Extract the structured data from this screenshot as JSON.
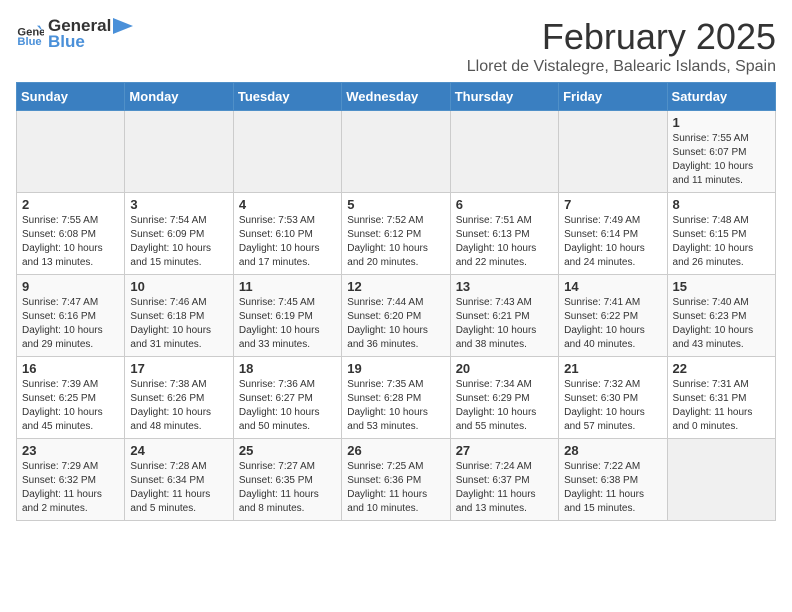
{
  "logo": {
    "line1": "General",
    "line2": "Blue"
  },
  "title": "February 2025",
  "subtitle": "Lloret de Vistalegre, Balearic Islands, Spain",
  "days_of_week": [
    "Sunday",
    "Monday",
    "Tuesday",
    "Wednesday",
    "Thursday",
    "Friday",
    "Saturday"
  ],
  "weeks": [
    [
      {
        "day": "",
        "detail": ""
      },
      {
        "day": "",
        "detail": ""
      },
      {
        "day": "",
        "detail": ""
      },
      {
        "day": "",
        "detail": ""
      },
      {
        "day": "",
        "detail": ""
      },
      {
        "day": "",
        "detail": ""
      },
      {
        "day": "1",
        "detail": "Sunrise: 7:55 AM\nSunset: 6:07 PM\nDaylight: 10 hours and 11 minutes."
      }
    ],
    [
      {
        "day": "2",
        "detail": "Sunrise: 7:55 AM\nSunset: 6:08 PM\nDaylight: 10 hours and 13 minutes."
      },
      {
        "day": "3",
        "detail": "Sunrise: 7:54 AM\nSunset: 6:09 PM\nDaylight: 10 hours and 15 minutes."
      },
      {
        "day": "4",
        "detail": "Sunrise: 7:53 AM\nSunset: 6:10 PM\nDaylight: 10 hours and 17 minutes."
      },
      {
        "day": "5",
        "detail": "Sunrise: 7:52 AM\nSunset: 6:12 PM\nDaylight: 10 hours and 20 minutes."
      },
      {
        "day": "6",
        "detail": "Sunrise: 7:51 AM\nSunset: 6:13 PM\nDaylight: 10 hours and 22 minutes."
      },
      {
        "day": "7",
        "detail": "Sunrise: 7:49 AM\nSunset: 6:14 PM\nDaylight: 10 hours and 24 minutes."
      },
      {
        "day": "8",
        "detail": "Sunrise: 7:48 AM\nSunset: 6:15 PM\nDaylight: 10 hours and 26 minutes."
      }
    ],
    [
      {
        "day": "9",
        "detail": "Sunrise: 7:47 AM\nSunset: 6:16 PM\nDaylight: 10 hours and 29 minutes."
      },
      {
        "day": "10",
        "detail": "Sunrise: 7:46 AM\nSunset: 6:18 PM\nDaylight: 10 hours and 31 minutes."
      },
      {
        "day": "11",
        "detail": "Sunrise: 7:45 AM\nSunset: 6:19 PM\nDaylight: 10 hours and 33 minutes."
      },
      {
        "day": "12",
        "detail": "Sunrise: 7:44 AM\nSunset: 6:20 PM\nDaylight: 10 hours and 36 minutes."
      },
      {
        "day": "13",
        "detail": "Sunrise: 7:43 AM\nSunset: 6:21 PM\nDaylight: 10 hours and 38 minutes."
      },
      {
        "day": "14",
        "detail": "Sunrise: 7:41 AM\nSunset: 6:22 PM\nDaylight: 10 hours and 40 minutes."
      },
      {
        "day": "15",
        "detail": "Sunrise: 7:40 AM\nSunset: 6:23 PM\nDaylight: 10 hours and 43 minutes."
      }
    ],
    [
      {
        "day": "16",
        "detail": "Sunrise: 7:39 AM\nSunset: 6:25 PM\nDaylight: 10 hours and 45 minutes."
      },
      {
        "day": "17",
        "detail": "Sunrise: 7:38 AM\nSunset: 6:26 PM\nDaylight: 10 hours and 48 minutes."
      },
      {
        "day": "18",
        "detail": "Sunrise: 7:36 AM\nSunset: 6:27 PM\nDaylight: 10 hours and 50 minutes."
      },
      {
        "day": "19",
        "detail": "Sunrise: 7:35 AM\nSunset: 6:28 PM\nDaylight: 10 hours and 53 minutes."
      },
      {
        "day": "20",
        "detail": "Sunrise: 7:34 AM\nSunset: 6:29 PM\nDaylight: 10 hours and 55 minutes."
      },
      {
        "day": "21",
        "detail": "Sunrise: 7:32 AM\nSunset: 6:30 PM\nDaylight: 10 hours and 57 minutes."
      },
      {
        "day": "22",
        "detail": "Sunrise: 7:31 AM\nSunset: 6:31 PM\nDaylight: 11 hours and 0 minutes."
      }
    ],
    [
      {
        "day": "23",
        "detail": "Sunrise: 7:29 AM\nSunset: 6:32 PM\nDaylight: 11 hours and 2 minutes."
      },
      {
        "day": "24",
        "detail": "Sunrise: 7:28 AM\nSunset: 6:34 PM\nDaylight: 11 hours and 5 minutes."
      },
      {
        "day": "25",
        "detail": "Sunrise: 7:27 AM\nSunset: 6:35 PM\nDaylight: 11 hours and 8 minutes."
      },
      {
        "day": "26",
        "detail": "Sunrise: 7:25 AM\nSunset: 6:36 PM\nDaylight: 11 hours and 10 minutes."
      },
      {
        "day": "27",
        "detail": "Sunrise: 7:24 AM\nSunset: 6:37 PM\nDaylight: 11 hours and 13 minutes."
      },
      {
        "day": "28",
        "detail": "Sunrise: 7:22 AM\nSunset: 6:38 PM\nDaylight: 11 hours and 15 minutes."
      },
      {
        "day": "",
        "detail": ""
      }
    ]
  ]
}
